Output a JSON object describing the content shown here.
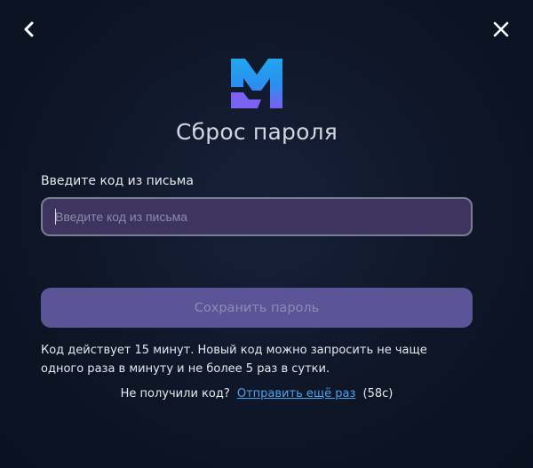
{
  "header": {
    "back_icon": "chevron-left-icon",
    "close_icon": "close-icon",
    "logo_icon": "brand-m-logo"
  },
  "title": "Сброс пароля",
  "form": {
    "code_label": "Введите код из письма",
    "code_value": "",
    "code_placeholder": "Введите код из письма",
    "save_label": "Сохранить пароль"
  },
  "info": {
    "line1": "Код действует 15 минут. Новый код можно запросить не чаще",
    "line2": "одного раза в минуту и не более 5 раз в сутки."
  },
  "resend": {
    "prompt": "Не получили код?",
    "link_label": "Отправить ещё раз",
    "countdown": "(58с)"
  },
  "colors": {
    "background": "#0e1627",
    "input_bg": "#3d3560",
    "button_bg": "#5b5496",
    "link": "#4ea2ec",
    "logo_blue": "#1fa0ec",
    "logo_purple": "#7b62f0"
  }
}
